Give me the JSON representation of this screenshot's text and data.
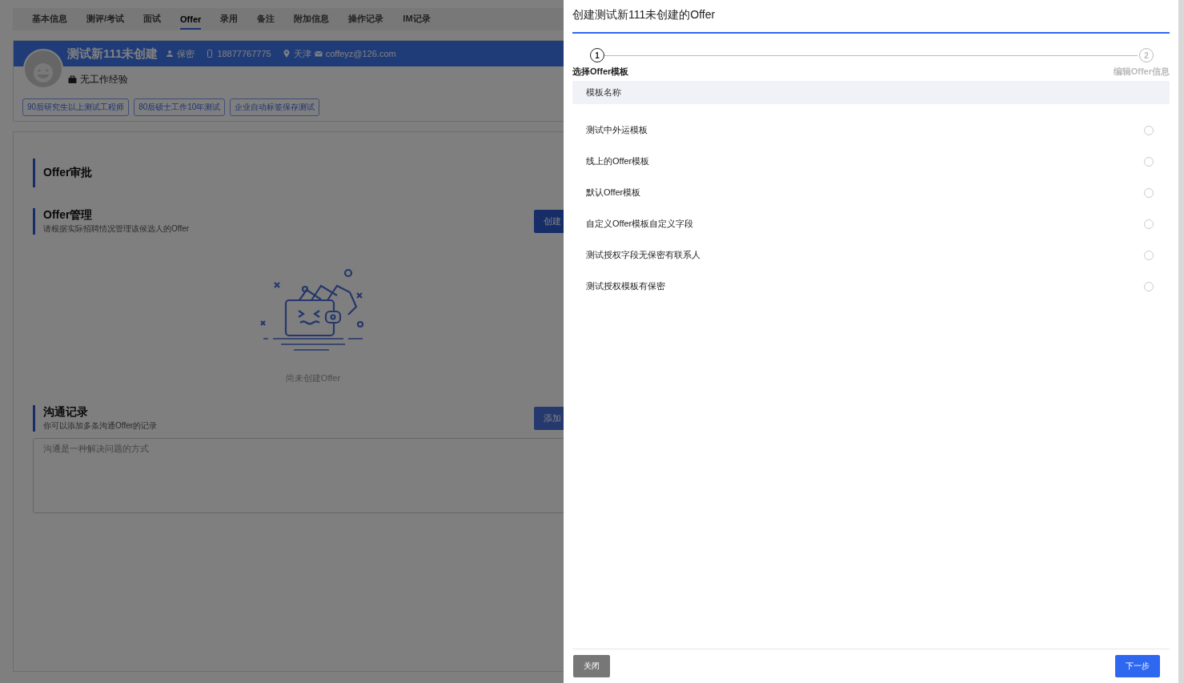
{
  "tabs": [
    {
      "label": "基本信息",
      "selected": false
    },
    {
      "label": "测评/考试",
      "selected": false
    },
    {
      "label": "面试",
      "selected": false
    },
    {
      "label": "Offer",
      "selected": true
    },
    {
      "label": "录用",
      "selected": false
    },
    {
      "label": "备注",
      "selected": false
    },
    {
      "label": "附加信息",
      "selected": false
    },
    {
      "label": "操作记录",
      "selected": false
    },
    {
      "label": "IM记录",
      "selected": false
    }
  ],
  "candidate": {
    "name": "测试新111未创建",
    "gender": "保密",
    "phone": "18877767775",
    "city": "天津",
    "email": "coffeyz@126.com",
    "experience": "无工作经验",
    "tags": [
      "90后研究生以上测试工程师",
      "80后硕士工作10年测试",
      "企业自动标签保存测试"
    ]
  },
  "approval": {
    "title": "Offer审批"
  },
  "management": {
    "title": "Offer管理",
    "subtitle": "请根据实际招聘情况管理该候选人的Offer",
    "button": "创建",
    "empty_text": "尚未创建Offer"
  },
  "communication": {
    "title": "沟通记录",
    "subtitle": "你可以添加多条沟通Offer的记录",
    "button": "添加",
    "placeholder": "沟通是一种解决问题的方式"
  },
  "drawer": {
    "title": "创建测试新111未创建的Offer",
    "steps": [
      {
        "number": "1",
        "label": "选择Offer模板",
        "selected": true
      },
      {
        "number": "2",
        "label": "编辑Offer信息",
        "selected": false
      }
    ],
    "column": "模板名称",
    "templates": [
      {
        "name": "测试中外运模板",
        "selected": false
      },
      {
        "name": "线上的Offer模板",
        "selected": false
      },
      {
        "name": "默认Offer模板",
        "selected": false
      },
      {
        "name": "自定义Offer模板自定义字段",
        "selected": false
      },
      {
        "name": "测试授权字段无保密有联系人",
        "selected": false
      },
      {
        "name": "测试授权模板有保密",
        "selected": false
      }
    ],
    "close_button": "关闭",
    "next_button": "下一步"
  }
}
